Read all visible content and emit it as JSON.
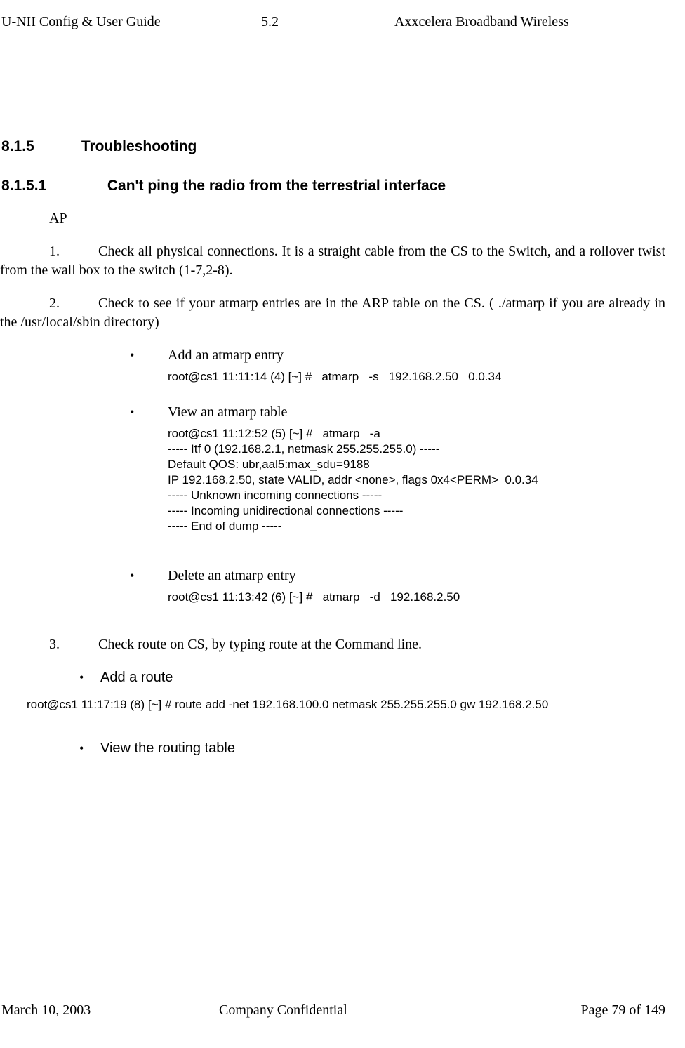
{
  "header": {
    "left": "U-NII Config & User Guide",
    "center": "5.2",
    "right": "Axxcelera Broadband Wireless"
  },
  "sections": {
    "h815_num": "8.1.5",
    "h815_title": "Troubleshooting",
    "h8151_num": "8.1.5.1",
    "h8151_title": "Can't ping the radio from the terrestrial interface"
  },
  "ap": "AP",
  "items": {
    "n1_label": "1.",
    "n1_text": "Check all physical connections. It is a straight cable from the CS to the Switch, and a rollover twist from the wall box to the switch (1-7,2-8).",
    "n2_label": "2.",
    "n2_text": "Check to see if your atmarp entries are in the ARP table on the CS. (  ./atmarp if you are already in the /usr/local/sbin directory)",
    "n3_label": "3.",
    "n3_text": "Check route on CS, by typing route at the Command line."
  },
  "bullets": {
    "dot": "•",
    "add_atmarp": "Add an atmarp entry",
    "add_atmarp_code": "root@cs1 11:11:14 (4) [~] #   atmarp   -s   192.168.2.50   0.0.34",
    "view_atmarp": "View an atmarp table",
    "view_atmarp_code": "root@cs1 11:12:52 (5) [~] #   atmarp   -a\n----- Itf 0 (192.168.2.1, netmask 255.255.255.0) -----\nDefault QOS: ubr,aal5:max_sdu=9188\nIP 192.168.2.50, state VALID, addr <none>, flags 0x4<PERM>  0.0.34\n----- Unknown incoming connections -----\n----- Incoming unidirectional connections -----\n----- End of dump -----",
    "del_atmarp": "Delete an atmarp entry",
    "del_atmarp_code": "root@cs1 11:13:42 (6) [~] #   atmarp   -d   192.168.2.50",
    "add_route": "Add a route",
    "add_route_code": "root@cs1 11:17:19 (8) [~] #   route   add   -net   192.168.100.0   netmask   255.255.255.0   gw   192.168.2.50",
    "view_routing": "View the routing table"
  },
  "footer": {
    "left": "March 10, 2003",
    "center": "Company Confidential",
    "right": "Page 79 of 149"
  }
}
